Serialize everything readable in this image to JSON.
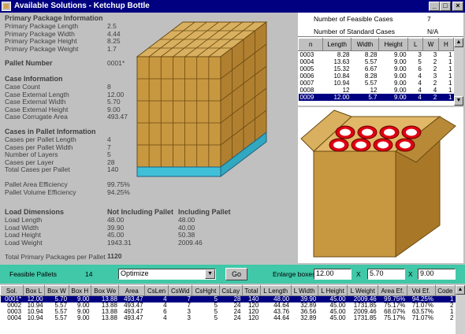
{
  "window": {
    "title": "Available Solutions - Ketchup Bottle",
    "min": "_",
    "max": "□",
    "close": "×"
  },
  "info": {
    "primary_header": "Primary Package Information",
    "primary": [
      {
        "label": "Primary Package Length",
        "value": "2.5"
      },
      {
        "label": "Primary Package Width",
        "value": "4.44"
      },
      {
        "label": "Primary Package Height",
        "value": "8.25"
      },
      {
        "label": "Primary Package Weight",
        "value": "1.7"
      }
    ],
    "pallet_label": "Pallet Number",
    "pallet_value": "0001*",
    "case_header": "Case Information",
    "case": [
      {
        "label": "Case Count",
        "value": "8"
      },
      {
        "label": "Case External Length",
        "value": "12.00"
      },
      {
        "label": "Case External Width",
        "value": "5.70"
      },
      {
        "label": "Case External Height",
        "value": "9.00"
      },
      {
        "label": "Case Corrugate Area",
        "value": "493.47"
      }
    ],
    "cases_header": "Cases in Pallet Information",
    "cases": [
      {
        "label": "Cases per Pallet Length",
        "value": "4"
      },
      {
        "label": "Cases per Pallet Width",
        "value": "7"
      },
      {
        "label": "Number of Layers",
        "value": "5"
      },
      {
        "label": "Cases per Layer",
        "value": "28"
      },
      {
        "label": "Total Cases per Pallet",
        "value": "140"
      }
    ],
    "eff": [
      {
        "label": "Pallet Area Efficiency",
        "value": "99.75%"
      },
      {
        "label": "Pallet Volume Efficiency",
        "value": "94.25%"
      }
    ],
    "load_header": "Load Dimensions",
    "col_not": "Not Including Pallet",
    "col_inc": "Including Pallet",
    "load": [
      {
        "label": "Load Length",
        "a": "48.00",
        "b": "48.00"
      },
      {
        "label": "Load Width",
        "a": "39.90",
        "b": "40.00"
      },
      {
        "label": "Load Height",
        "a": "45.00",
        "b": "50.38"
      },
      {
        "label": "Load Weight",
        "a": "1943.31",
        "b": "2009.46"
      }
    ],
    "total_label": "Total Primary Packages per Pallet",
    "total_value": "1120"
  },
  "summary": {
    "feasible_label": "Number of Feasible Cases",
    "feasible_value": "7",
    "standard_label": "Number of Standard Cases",
    "standard_value": "N/A"
  },
  "cases_grid": {
    "headers": [
      "n",
      "Length",
      "Width",
      "Height",
      "L",
      "W",
      "H"
    ],
    "rows": [
      [
        "0003",
        "8.28",
        "8.28",
        "9.00",
        "3",
        "3",
        "1"
      ],
      [
        "0004",
        "13.63",
        "5.57",
        "9.00",
        "5",
        "2",
        "1"
      ],
      [
        "0005",
        "15.32",
        "6.67",
        "9.00",
        "6",
        "2",
        "1"
      ],
      [
        "0006",
        "10.84",
        "8.28",
        "9.00",
        "4",
        "3",
        "1"
      ],
      [
        "0007",
        "10.94",
        "5.57",
        "9.00",
        "4",
        "2",
        "1"
      ],
      [
        "0008",
        "12",
        "12",
        "9.00",
        "4",
        "4",
        "1"
      ],
      [
        "0009",
        "12.00",
        "5.7",
        "9.00",
        "4",
        "2",
        "1"
      ]
    ],
    "selected": 6
  },
  "controls": {
    "feasible_pallets_label": "Feasible Pallets",
    "feasible_pallets_value": "14",
    "optimize_value": "Optimize",
    "go_label": "Go",
    "enlarge_label": "Enlarge boxes",
    "x_sep": "X",
    "enlarge1": "12.00",
    "enlarge2": "5.70",
    "enlarge3": "9.00"
  },
  "solutions": {
    "headers": [
      "Sol.",
      "Box L",
      "Box W",
      "Box H",
      "Box We",
      "Area",
      "CsLen",
      "CsWid",
      "CsHght",
      "CsLay",
      "Total",
      "L Length",
      "L Width",
      "L Height",
      "L Weight",
      "Area Ef.",
      "Vol Ef.",
      "Code"
    ],
    "rows": [
      [
        "0001*",
        "12.00",
        "5.70",
        "9.00",
        "13.88",
        "493.47",
        "4",
        "7",
        "5",
        "28",
        "140",
        "48.00",
        "39.90",
        "45.00",
        "2009.46",
        "99.75%",
        "94.25%",
        "1"
      ],
      [
        "0002",
        "10.94",
        "5.57",
        "9.00",
        "13.88",
        "493.47",
        "4",
        "7",
        "5",
        "24",
        "120",
        "44.64",
        "32.89",
        "45.00",
        "1731.85",
        "75.17%",
        "71.07%",
        "2"
      ],
      [
        "0003",
        "10.94",
        "5.57",
        "9.00",
        "13.88",
        "493.47",
        "6",
        "3",
        "5",
        "24",
        "120",
        "43.76",
        "36.56",
        "45.00",
        "2009.46",
        "68.07%",
        "63.57%",
        "1"
      ],
      [
        "0004",
        "10.94",
        "5.57",
        "9.00",
        "13.88",
        "493.47",
        "4",
        "3",
        "5",
        "24",
        "120",
        "44.64",
        "32.89",
        "45.00",
        "1731.85",
        "75.17%",
        "71.07%",
        "2"
      ]
    ],
    "selected": 0
  },
  "colors": {
    "title": "#000080",
    "select": "#000080",
    "bar": "#40c8a8",
    "carton": "#c8a050",
    "pallet": "#40c0d8",
    "bottle_cap": "#e00010"
  }
}
